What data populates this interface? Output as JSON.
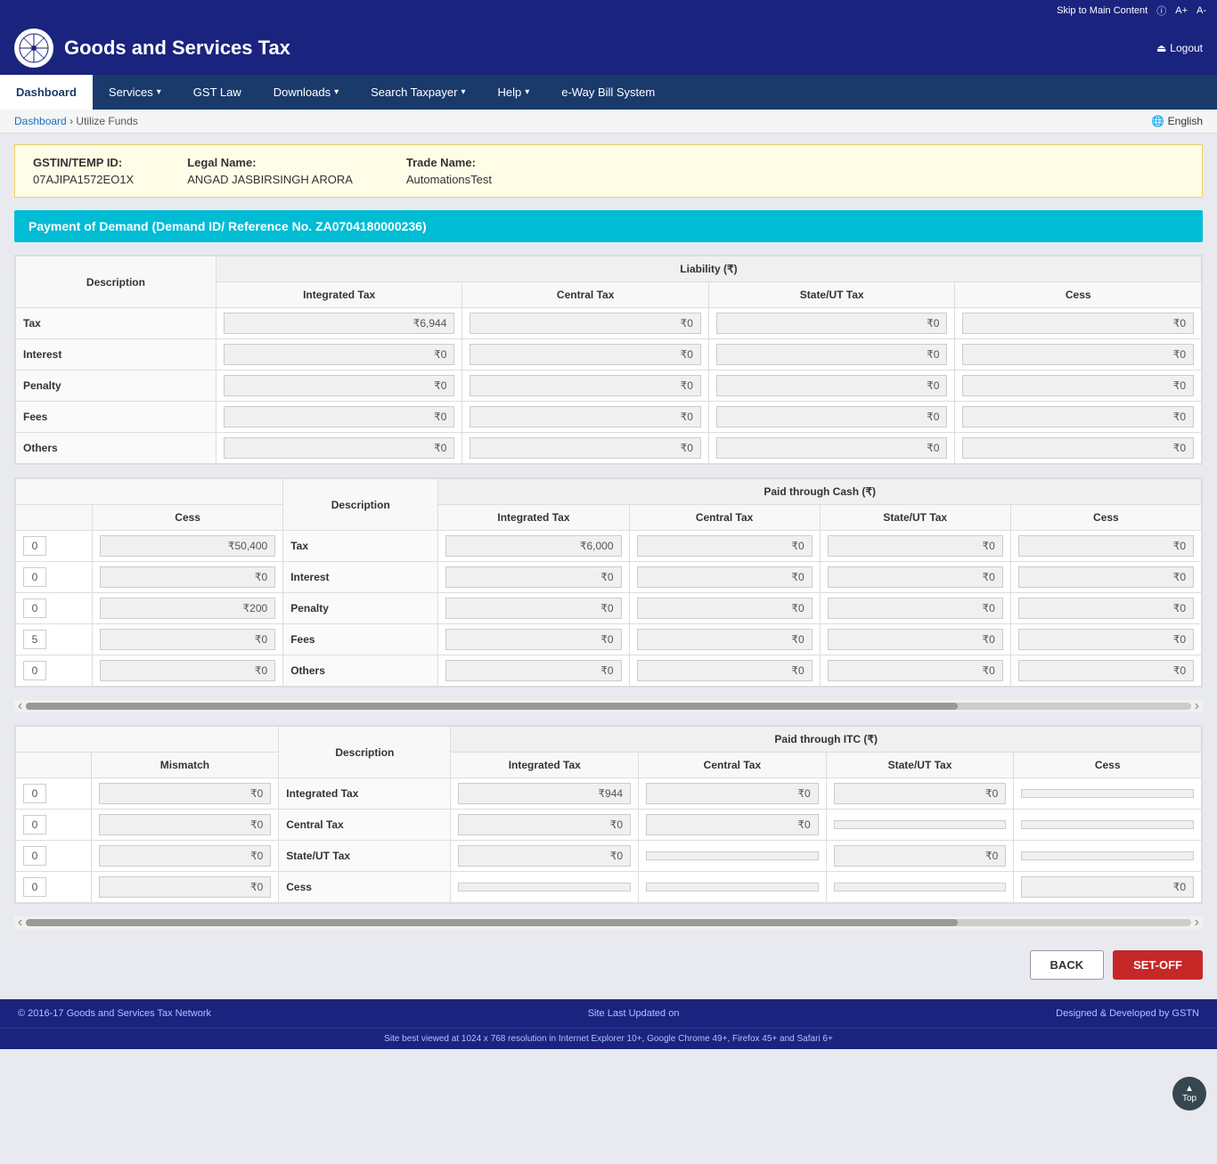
{
  "topbar": {
    "skip_label": "Skip to Main Content",
    "info_icon": "ⓘ",
    "font_large": "A+",
    "font_small": "A-",
    "logout_label": "Logout"
  },
  "header": {
    "logo_text": "GOI",
    "title": "Goods and Services Tax"
  },
  "nav": {
    "items": [
      {
        "label": "Dashboard",
        "active": false,
        "has_arrow": false
      },
      {
        "label": "Services",
        "active": false,
        "has_arrow": true
      },
      {
        "label": "GST Law",
        "active": false,
        "has_arrow": false
      },
      {
        "label": "Downloads",
        "active": false,
        "has_arrow": true
      },
      {
        "label": "Search Taxpayer",
        "active": false,
        "has_arrow": true
      },
      {
        "label": "Help",
        "active": false,
        "has_arrow": true
      },
      {
        "label": "e-Way Bill System",
        "active": false,
        "has_arrow": false
      }
    ]
  },
  "breadcrumb": {
    "dashboard": "Dashboard",
    "current": "Utilize Funds",
    "language": "English"
  },
  "info_card": {
    "gstin_label": "GSTIN/TEMP ID:",
    "gstin_value": "07AJIPA1572EO1X",
    "legal_label": "Legal Name:",
    "legal_value": "ANGAD JASBIRSINGH ARORA",
    "trade_label": "Trade Name:",
    "trade_value": "AutomationsTest"
  },
  "section_header": "Payment of Demand (Demand ID/ Reference No. ZA0704180000236)",
  "liability_table": {
    "title": "Liability (₹)",
    "col_desc": "Description",
    "col_integrated": "Integrated Tax",
    "col_central": "Central Tax",
    "col_state": "State/UT Tax",
    "col_cess": "Cess",
    "rows": [
      {
        "label": "Tax",
        "integrated": "₹6,944",
        "central": "₹0",
        "state": "₹0",
        "cess": "₹0"
      },
      {
        "label": "Interest",
        "integrated": "₹0",
        "central": "₹0",
        "state": "₹0",
        "cess": "₹0"
      },
      {
        "label": "Penalty",
        "integrated": "₹0",
        "central": "₹0",
        "state": "₹0",
        "cess": "₹0"
      },
      {
        "label": "Fees",
        "integrated": "₹0",
        "central": "₹0",
        "state": "₹0",
        "cess": "₹0"
      },
      {
        "label": "Others",
        "integrated": "₹0",
        "central": "₹0",
        "state": "₹0",
        "cess": "₹0"
      }
    ]
  },
  "cash_table": {
    "title": "Paid through Cash (₹)",
    "col_desc": "Description",
    "col_cess_left": "Cess",
    "col_integrated": "Integrated Tax",
    "col_central": "Central Tax",
    "col_state": "State/UT Tax",
    "col_cess": "Cess",
    "rows": [
      {
        "label": "Tax",
        "num_left": "0",
        "cess_left": "₹50,400",
        "integrated": "₹6,000",
        "central": "₹0",
        "state": "₹0",
        "cess": "₹0"
      },
      {
        "label": "Interest",
        "num_left": "0",
        "cess_left": "₹0",
        "integrated": "₹0",
        "central": "₹0",
        "state": "₹0",
        "cess": "₹0"
      },
      {
        "label": "Penalty",
        "num_left": "0",
        "cess_left": "₹200",
        "integrated": "₹0",
        "central": "₹0",
        "state": "₹0",
        "cess": "₹0"
      },
      {
        "label": "Fees",
        "num_left": "5",
        "cess_left": "₹0",
        "integrated": "₹0",
        "central": "₹0",
        "state": "₹0",
        "cess": "₹0"
      },
      {
        "label": "Others",
        "num_left": "0",
        "cess_left": "₹0",
        "integrated": "₹0",
        "central": "₹0",
        "state": "₹0",
        "cess": "₹0"
      }
    ]
  },
  "itc_table": {
    "title": "Paid through ITC (₹)",
    "col_desc": "Description",
    "col_mismatch": "Mismatch",
    "col_integrated": "Integrated Tax",
    "col_central": "Central Tax",
    "col_state": "State/UT Tax",
    "col_cess": "Cess",
    "rows": [
      {
        "label": "Integrated Tax",
        "num_left": "0",
        "mismatch": "₹0",
        "integrated": "₹944",
        "central": "₹0",
        "state": "₹0",
        "cess": ""
      },
      {
        "label": "Central Tax",
        "num_left": "0",
        "mismatch": "₹0",
        "integrated": "₹0",
        "central": "₹0",
        "state": "",
        "cess": ""
      },
      {
        "label": "State/UT Tax",
        "num_left": "0",
        "mismatch": "₹0",
        "integrated": "₹0",
        "central": "",
        "state": "₹0",
        "cess": ""
      },
      {
        "label": "Cess",
        "num_left": "0",
        "mismatch": "₹0",
        "integrated": "",
        "central": "",
        "state": "",
        "cess": "₹0"
      }
    ]
  },
  "buttons": {
    "back": "BACK",
    "setoff": "SET-OFF"
  },
  "footer": {
    "copyright": "© 2016-17 Goods and Services Tax Network",
    "updated": "Site Last Updated on",
    "designed": "Designed & Developed by GSTN",
    "browser_note": "Site best viewed at 1024 x 768 resolution in Internet Explorer 10+, Google Chrome 49+, Firefox 45+ and Safari 6+"
  },
  "scroll_top": "Top"
}
